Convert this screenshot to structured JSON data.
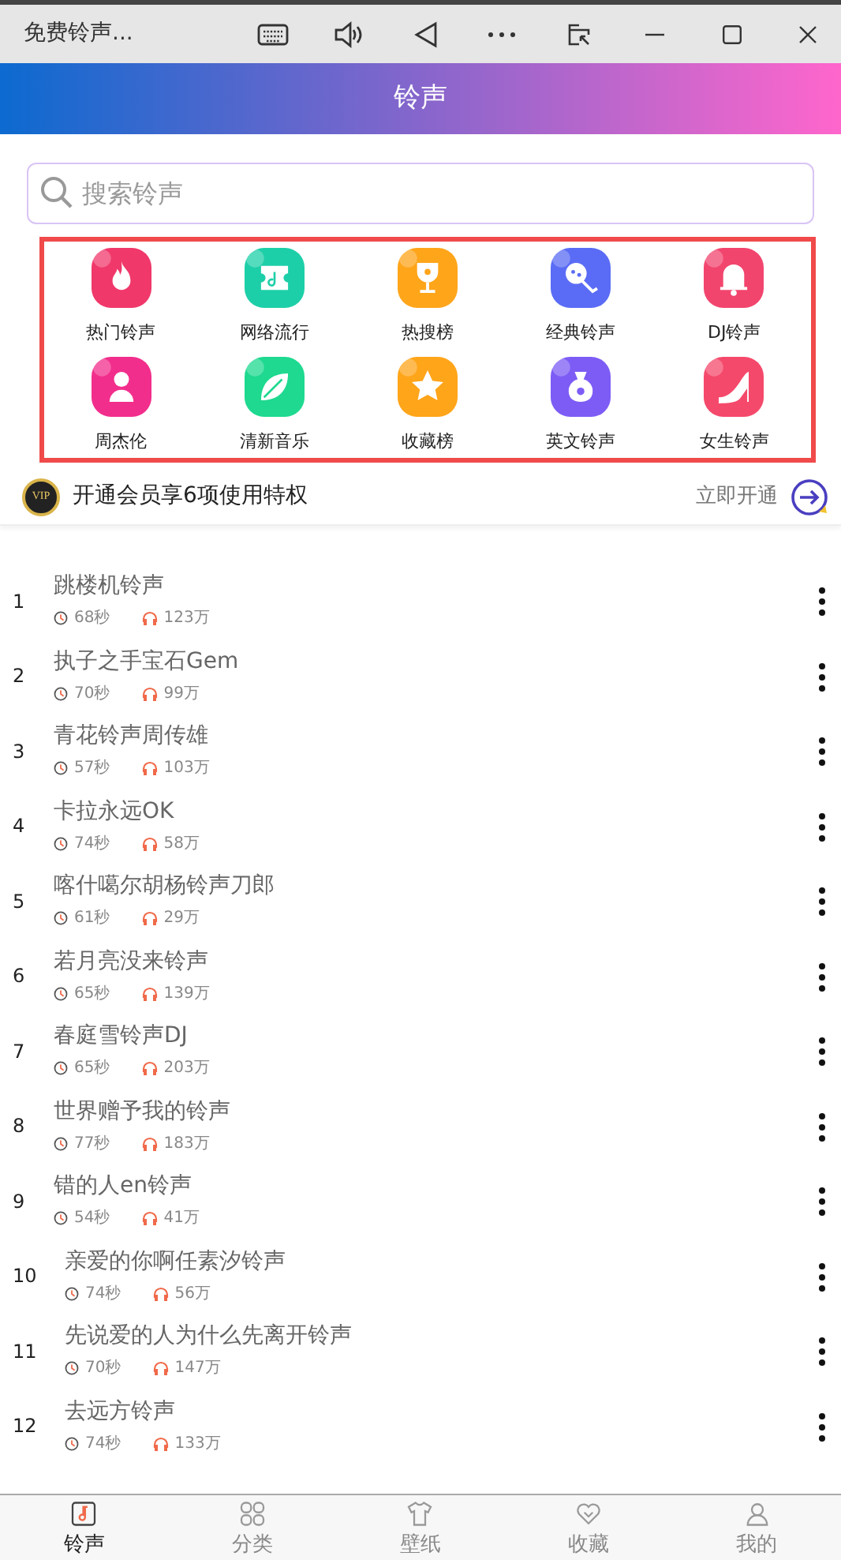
{
  "window": {
    "title": "免费铃声..."
  },
  "header": {
    "title": "铃声"
  },
  "search": {
    "placeholder": "搜索铃声"
  },
  "categories": [
    {
      "label": "热门铃声",
      "color": "#f0386b"
    },
    {
      "label": "网络流行",
      "color": "#1dcfa8"
    },
    {
      "label": "热搜榜",
      "color": "#ffa51a"
    },
    {
      "label": "经典铃声",
      "color": "#5a6cf5"
    },
    {
      "label": "DJ铃声",
      "color": "#f2456e"
    },
    {
      "label": "周杰伦",
      "color": "#f22e8c"
    },
    {
      "label": "清新音乐",
      "color": "#1ed98f"
    },
    {
      "label": "收藏榜",
      "color": "#ffa51a"
    },
    {
      "label": "英文铃声",
      "color": "#7d5cf5"
    },
    {
      "label": "女生铃声",
      "color": "#f5496b"
    }
  ],
  "vip": {
    "badge": "VIP",
    "text": "开通会员享6项使用特权",
    "action": "立即开通"
  },
  "ringtones": [
    {
      "rank": "1",
      "title": "跳楼机铃声",
      "duration": "68秒",
      "plays": "123万"
    },
    {
      "rank": "2",
      "title": "执子之手宝石Gem",
      "duration": "70秒",
      "plays": "99万"
    },
    {
      "rank": "3",
      "title": "青花铃声周传雄",
      "duration": "57秒",
      "plays": "103万"
    },
    {
      "rank": "4",
      "title": "卡拉永远OK",
      "duration": "74秒",
      "plays": "58万"
    },
    {
      "rank": "5",
      "title": "喀什噶尔胡杨铃声刀郎",
      "duration": "61秒",
      "plays": "29万"
    },
    {
      "rank": "6",
      "title": "若月亮没来铃声",
      "duration": "65秒",
      "plays": "139万"
    },
    {
      "rank": "7",
      "title": "春庭雪铃声DJ",
      "duration": "65秒",
      "plays": "203万"
    },
    {
      "rank": "8",
      "title": "世界赠予我的铃声",
      "duration": "77秒",
      "plays": "183万"
    },
    {
      "rank": "9",
      "title": "错的人en铃声",
      "duration": "54秒",
      "plays": "41万"
    },
    {
      "rank": "10",
      "title": "亲爱的你啊任素汐铃声",
      "duration": "74秒",
      "plays": "56万"
    },
    {
      "rank": "11",
      "title": "先说爱的人为什么先离开铃声",
      "duration": "70秒",
      "plays": "147万"
    },
    {
      "rank": "12",
      "title": "去远方铃声",
      "duration": "74秒",
      "plays": "133万"
    }
  ],
  "bottom_nav": [
    {
      "label": "铃声",
      "selected": true
    },
    {
      "label": "分类",
      "selected": false
    },
    {
      "label": "壁纸",
      "selected": false
    },
    {
      "label": "收藏",
      "selected": false
    },
    {
      "label": "我的",
      "selected": false
    }
  ]
}
